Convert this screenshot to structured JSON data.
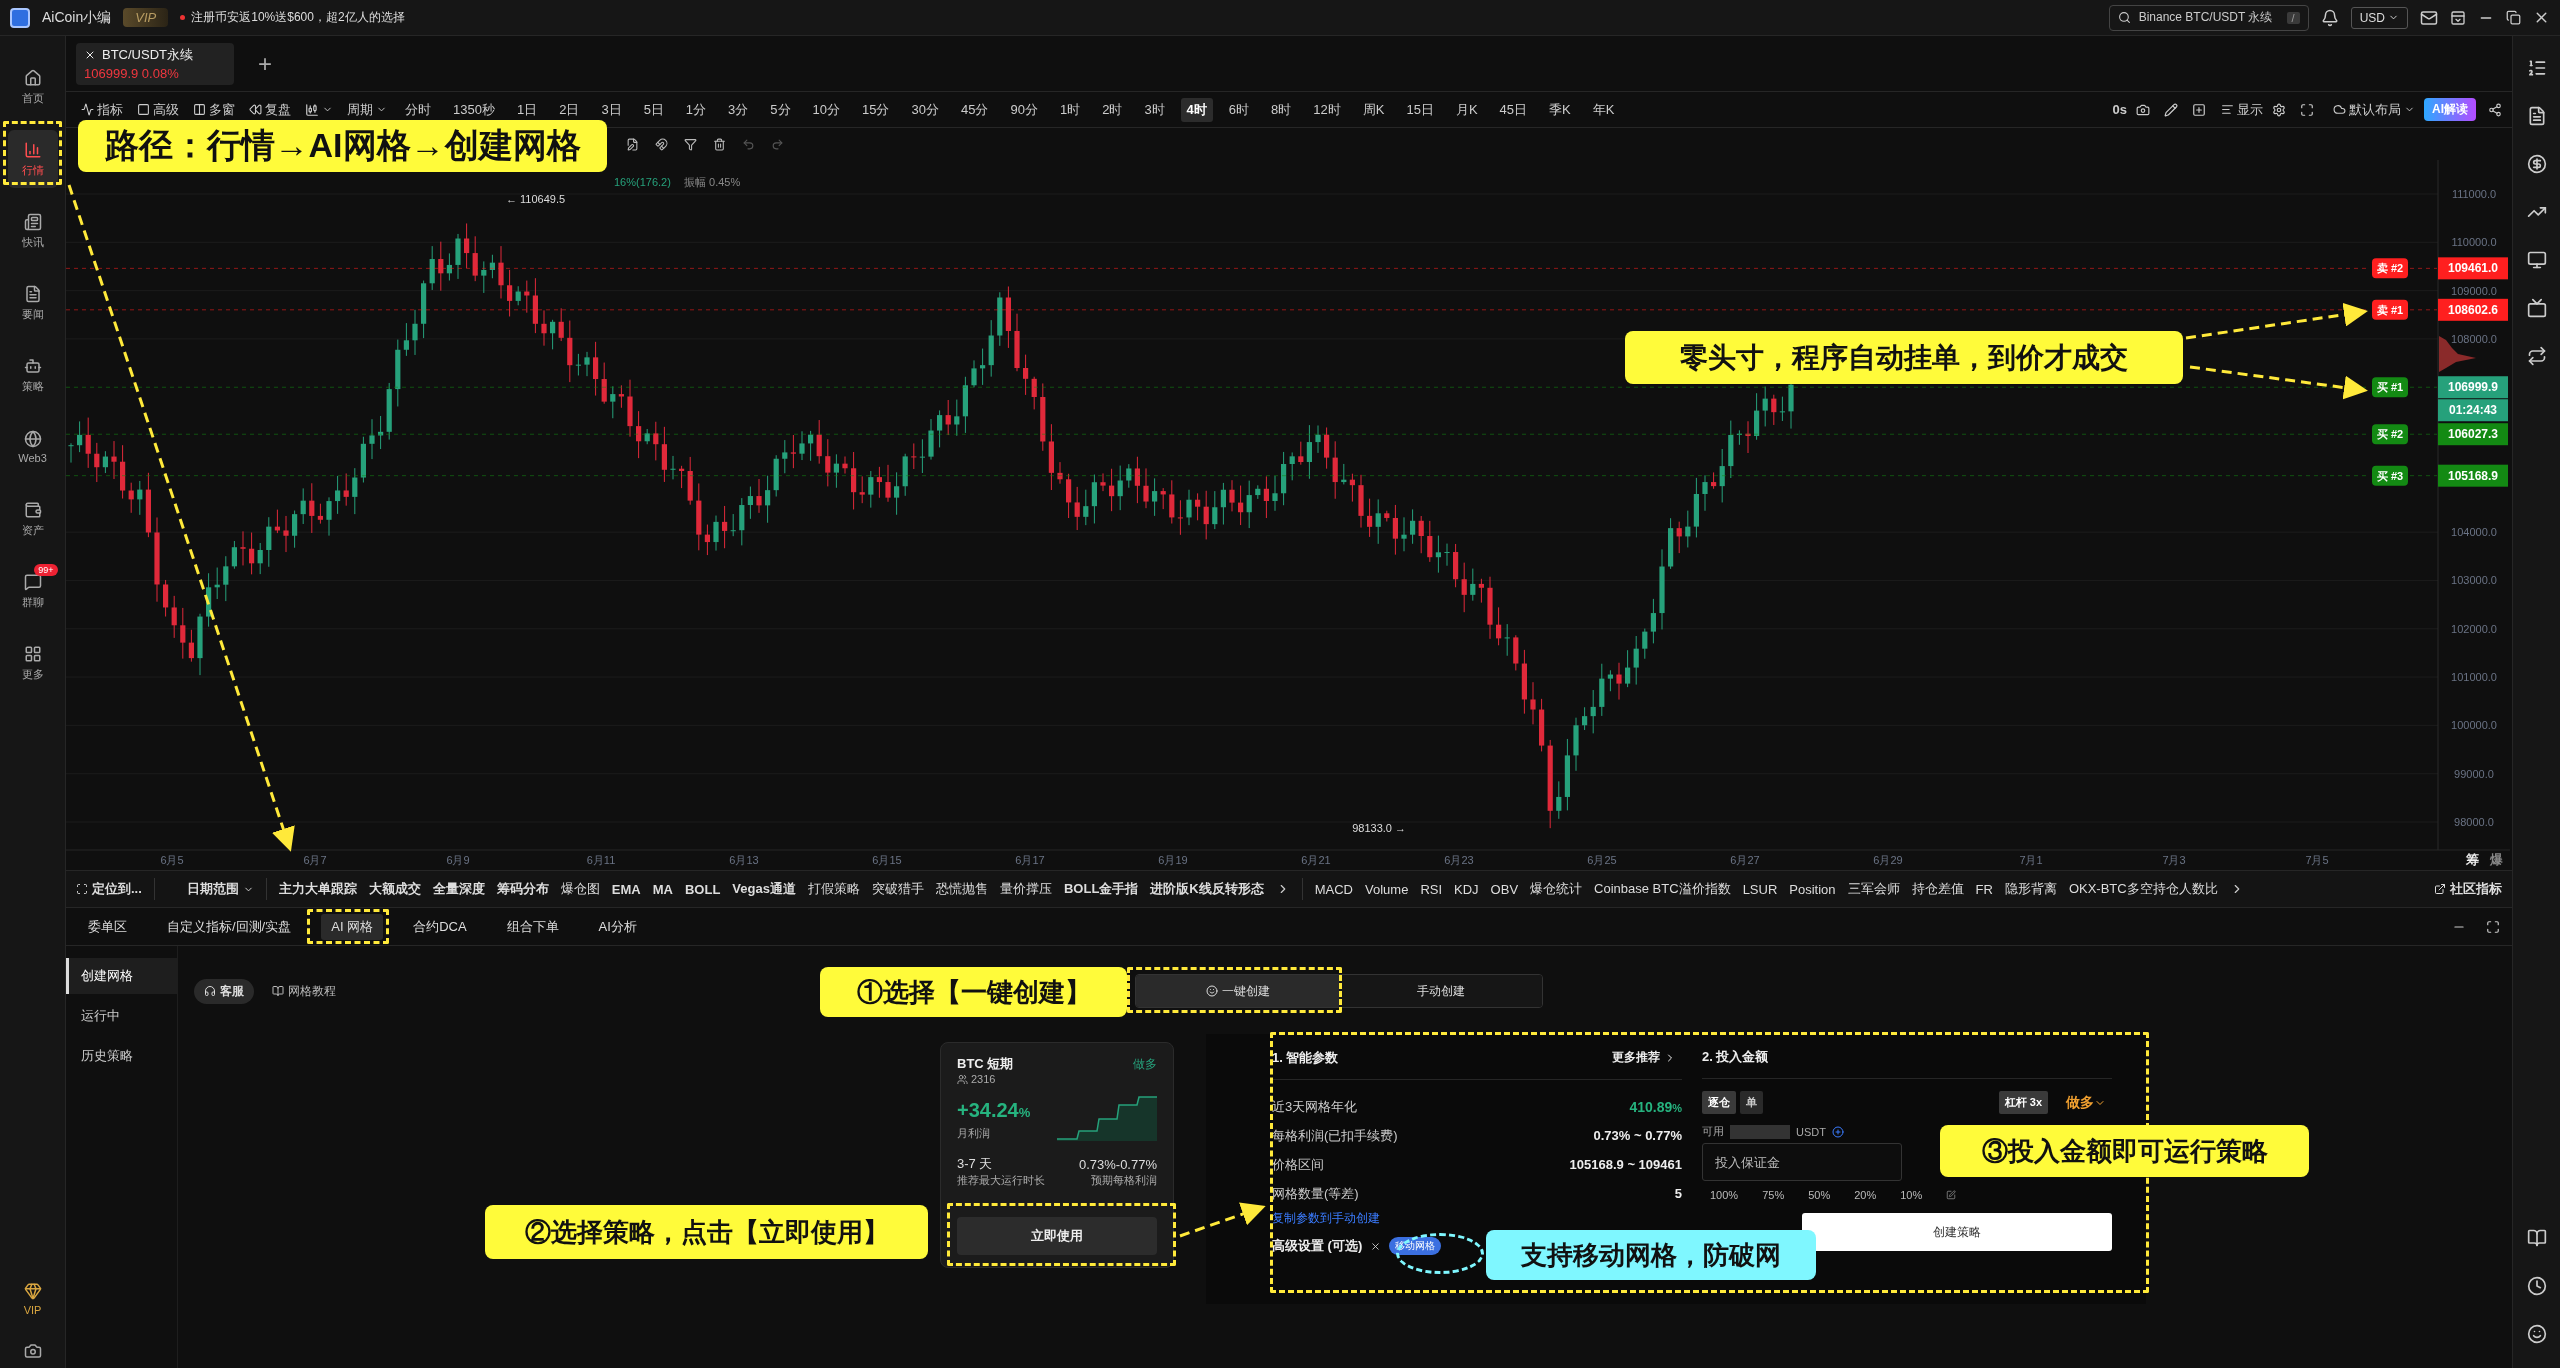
{
  "title_bar": {
    "app_name": "AiCoin小编",
    "vip_badge": "VIP",
    "promo": "注册币安返10%送$600，超2亿人的选择",
    "search": {
      "value": "Binance BTC/USDT 永续",
      "shortcut": "/"
    },
    "currency": "USD"
  },
  "left_nav": [
    {
      "label": "首页",
      "selected": false
    },
    {
      "label": "行情",
      "selected": true
    },
    {
      "label": "快讯",
      "selected": false
    },
    {
      "label": "要闻",
      "selected": false
    },
    {
      "label": "策略",
      "selected": false
    },
    {
      "label": "Web3",
      "selected": false
    },
    {
      "label": "资产",
      "selected": false
    },
    {
      "label": "群聊",
      "selected": false,
      "badge": "99+"
    },
    {
      "label": "更多",
      "selected": false
    }
  ],
  "left_nav_bottom": {
    "label": "VIP"
  },
  "chart_tab": {
    "symbol": "BTC/USDT永续",
    "price": "106999.9",
    "change": "0.08%",
    "add": "+"
  },
  "toolbar": {
    "tools": [
      "指标",
      "高级",
      "多窗",
      "复盘"
    ],
    "period_menu": "周期",
    "intervals": [
      {
        "label": "分时",
        "selected": false
      },
      {
        "label": "1350秒",
        "selected": false
      },
      {
        "label": "1日",
        "selected": false
      },
      {
        "label": "2日",
        "selected": false
      },
      {
        "label": "3日",
        "selected": false
      },
      {
        "label": "5日",
        "selected": false
      },
      {
        "label": "1分",
        "selected": false
      },
      {
        "label": "3分",
        "selected": false
      },
      {
        "label": "5分",
        "selected": false
      },
      {
        "label": "10分",
        "selected": false
      },
      {
        "label": "15分",
        "selected": false
      },
      {
        "label": "30分",
        "selected": false
      },
      {
        "label": "45分",
        "selected": false
      },
      {
        "label": "90分",
        "selected": false
      },
      {
        "label": "1时",
        "selected": false
      },
      {
        "label": "2时",
        "selected": false
      },
      {
        "label": "3时",
        "selected": false
      },
      {
        "label": "4时",
        "selected": true
      },
      {
        "label": "6时",
        "selected": false
      },
      {
        "label": "8时",
        "selected": false
      },
      {
        "label": "12时",
        "selected": false
      },
      {
        "label": "周K",
        "selected": false
      },
      {
        "label": "15日",
        "selected": false
      },
      {
        "label": "月K",
        "selected": false
      },
      {
        "label": "45日",
        "selected": false
      },
      {
        "label": "季K",
        "selected": false
      },
      {
        "label": "年K",
        "selected": false
      }
    ],
    "timer": "0s",
    "display": "显示",
    "layout": "默认布局",
    "ai_button": "AI解读"
  },
  "info_line": {
    "change": "16%(176.2)",
    "amplitude": "振幅 0.45%"
  },
  "chart": {
    "high_label": "← 110649.5",
    "low_label": "98133.0 →",
    "price_ticks": [
      "111000.0",
      "110000.0",
      "109000.0",
      "108000.0",
      "104000.0",
      "103000.0",
      "102000.0",
      "101000.0",
      "100000.0",
      "99000.0",
      "98000.0"
    ],
    "date_ticks": [
      "6月5",
      "6月7",
      "6月9",
      "6月11",
      "6月13",
      "6月15",
      "6月17",
      "6月19",
      "6月21",
      "6月23",
      "6月25",
      "6月27",
      "6月29",
      "7月1",
      "7月3",
      "7月5"
    ],
    "orders": [
      {
        "label": "卖 #2",
        "price": "109461.0",
        "color": "#ff1f1f",
        "current": false
      },
      {
        "label": "卖 #1",
        "price": "108602.6",
        "color": "#ff1f1f",
        "current": false
      },
      {
        "label": "买 #1",
        "price": "106999.9",
        "color": "#138a13",
        "current": true
      },
      {
        "label": "买 #2",
        "price": "106027.3",
        "color": "#138a13",
        "current": false
      },
      {
        "label": "买 #3",
        "price": "105168.9",
        "color": "#138a13",
        "current": false
      }
    ],
    "countdown": "01:24:43",
    "corner_labels": [
      "筹",
      "爆"
    ]
  },
  "indicator_bar": {
    "locate": "定位到...",
    "date_range": "日期范围",
    "left": [
      "主力大单跟踪",
      "大额成交",
      "全量深度",
      "筹码分布",
      "爆仓图",
      "EMA",
      "MA",
      "BOLL",
      "Vegas通道",
      "打假策略",
      "突破猎手",
      "恐慌抛售",
      "量价撑压",
      "BOLL金手指",
      "进阶版K线反转形态"
    ],
    "right": [
      "MACD",
      "Volume",
      "RSI",
      "KDJ",
      "OBV",
      "爆仓统计",
      "Coinbase BTC溢价指数",
      "LSUR",
      "Position",
      "三军会师",
      "持仓差值",
      "FR",
      "隐形背离",
      "OKX-BTC多空持仓人数比"
    ],
    "community": "社区指标"
  },
  "bottom_tabs": [
    {
      "label": "委单区",
      "selected": false
    },
    {
      "label": "自定义指标/回测/实盘",
      "selected": false
    },
    {
      "label": "AI 网格",
      "selected": true
    },
    {
      "label": "合约DCA",
      "selected": false
    },
    {
      "label": "组合下单",
      "selected": false
    },
    {
      "label": "AI分析",
      "selected": false
    }
  ],
  "grid_panel": {
    "side_nav": [
      {
        "label": "创建网格",
        "selected": true
      },
      {
        "label": "运行中",
        "selected": false
      },
      {
        "label": "历史策略",
        "selected": false
      }
    ],
    "support": "客服",
    "tutorial": "网格教程",
    "modes": [
      {
        "label": "一键创建",
        "selected": true
      },
      {
        "label": "手动创建",
        "selected": false
      }
    ],
    "strategy_card": {
      "title": "BTC 短期",
      "direction": "做多",
      "users": "2316",
      "profit": "+34.24",
      "profit_unit": "%",
      "profit_label": "月利润",
      "duration": "3-7 天",
      "duration_label": "推荐最大运行时长",
      "grid_profit": "0.73%-0.77%",
      "grid_profit_label": "预期每格利润",
      "button": "立即使用"
    },
    "params": {
      "title": "1. 智能参数",
      "more": "更多推荐",
      "rows": [
        {
          "label": "近3天网格年化",
          "value": "410.89",
          "unit": "%",
          "highlight": true
        },
        {
          "label": "每格利润(已扣手续费)",
          "value": "0.73% ~ 0.77%",
          "highlight": false
        },
        {
          "label": "价格区间",
          "value": "105168.9 ~ 109461",
          "highlight": false
        },
        {
          "label": "网格数量(等差)",
          "value": "5",
          "highlight": false
        }
      ],
      "copy_link": "复制参数到手动创建",
      "advanced": "高级设置 (可选)",
      "advanced_tag": "移动网格"
    },
    "amount": {
      "title": "2. 投入金额",
      "margin_modes": [
        {
          "label": "逐仓",
          "selected": true
        },
        {
          "label": "单",
          "selected": false
        }
      ],
      "leverage": "杠杆 3x",
      "direction": "做多",
      "available_label": "可用",
      "currency": "USDT",
      "placeholder": "投入保证金",
      "percents": [
        "100%",
        "75%",
        "50%",
        "20%",
        "10%"
      ],
      "submit": "创建策略"
    }
  },
  "annotations": [
    {
      "text": "路径：行情→AI网格→创建网格",
      "kind": "yellow"
    },
    {
      "text": "零头寸，程序自动挂单，到价才成交",
      "kind": "yellow"
    },
    {
      "text": "①选择【一键创建】",
      "kind": "yellow"
    },
    {
      "text": "②选择策略，点击【立即使用】",
      "kind": "yellow"
    },
    {
      "text": "③投入金额即可运行策略",
      "kind": "yellow"
    },
    {
      "text": "支持移动网格，防破网",
      "kind": "cyan"
    }
  ]
}
